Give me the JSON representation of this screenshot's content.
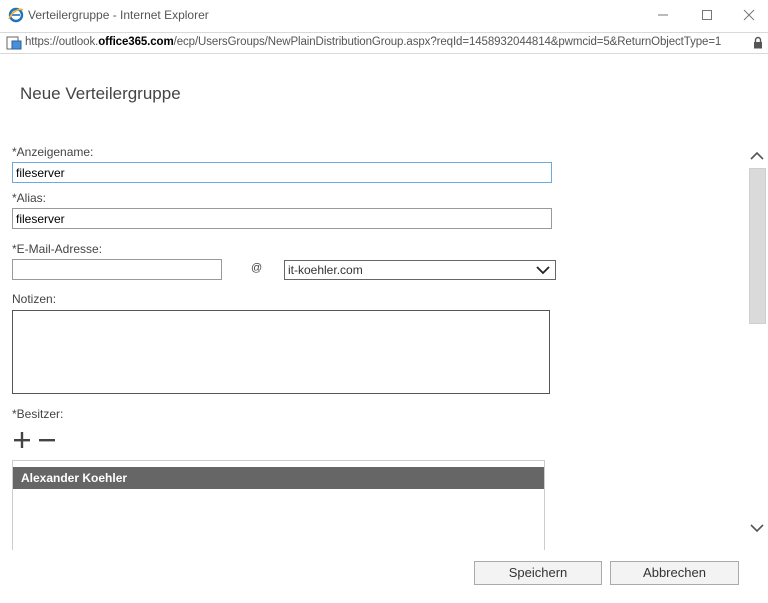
{
  "window": {
    "title": "Verteilergruppe - Internet Explorer",
    "url_prefix": "https://outlook.",
    "url_domain": "office365.com",
    "url_path": "/ecp/UsersGroups/NewPlainDistributionGroup.aspx?reqId=1458932044814&pwmcid=5&ReturnObjectType=1"
  },
  "page": {
    "title": "Neue Verteilergruppe"
  },
  "form": {
    "display_name_label": "*Anzeigename:",
    "display_name_value": "fileserver",
    "alias_label": "*Alias:",
    "alias_value": "fileserver",
    "email_label": "*E-Mail-Adresse:",
    "email_value": "",
    "at_sign": "@",
    "domain_selected": "it-koehler.com",
    "notes_label": "Notizen:",
    "notes_value": "",
    "owner_label": "*Besitzer:"
  },
  "owners": [
    "Alexander Koehler"
  ],
  "buttons": {
    "save": "Speichern",
    "cancel": "Abbrechen"
  },
  "icons": {
    "ie": "internet-explorer-icon",
    "page": "page-icon",
    "lock": "lock-icon",
    "add": "plus-icon",
    "remove": "minus-icon"
  },
  "colors": {
    "accent_ie": "#1e73be",
    "owner_row_bg": "#666666",
    "focus_border": "#6fa8dc"
  }
}
